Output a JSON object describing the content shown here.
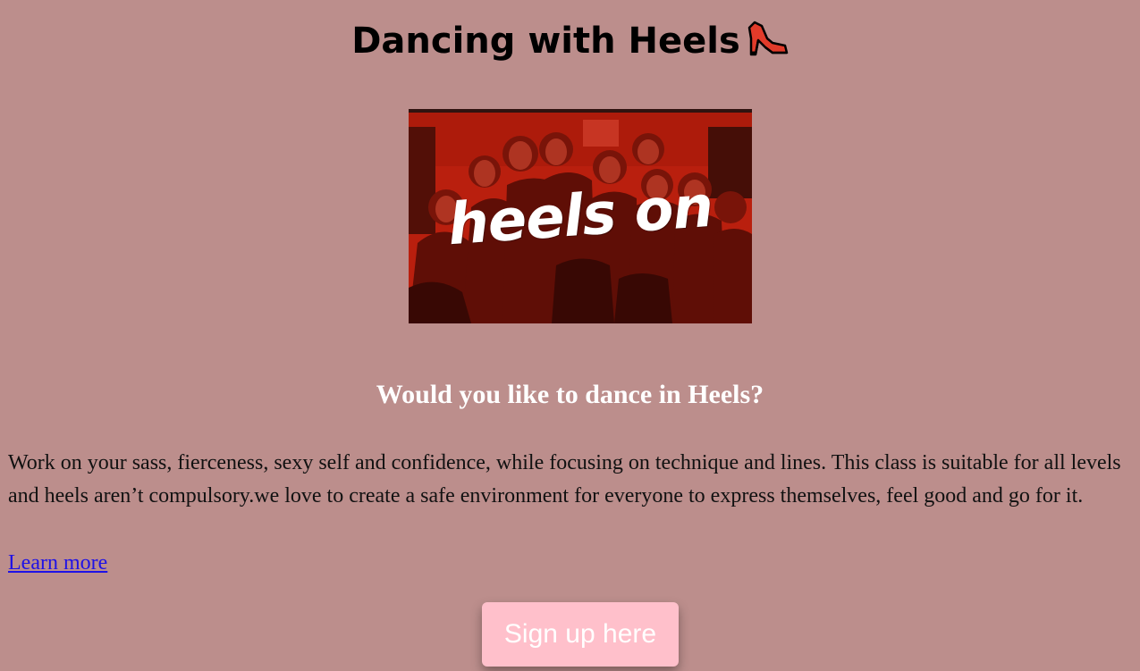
{
  "page": {
    "title": "Dancing with Heels",
    "title_icon": "high-heel-shoe-icon"
  },
  "hero": {
    "overlay_text": "heels on",
    "tint_color": "#c0200e"
  },
  "content": {
    "subheading": "Would you like to dance in Heels?",
    "description": "Work on your sass, fierceness, sexy self and confidence, while focusing on technique and lines. This class is suitable for all levels and heels aren’t compulsory.we love to create a safe environment for everyone to express themselves, feel good and go for it.",
    "learn_more_label": "Learn more"
  },
  "cta": {
    "signup_label": "Sign up here",
    "button_color": "#ffc0cb"
  },
  "colors": {
    "background": "#bc8e8c",
    "link": "#1f12e6"
  }
}
